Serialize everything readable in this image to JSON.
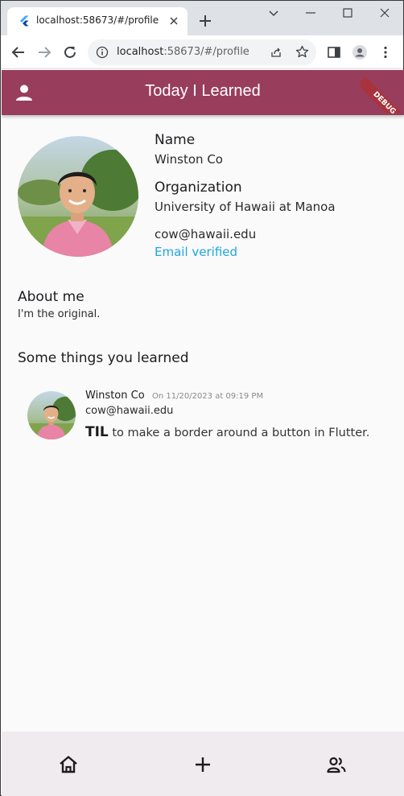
{
  "browser": {
    "tab_title": "localhost:58673/#/profile",
    "url_host": "localhost",
    "url_rest": ":58673/#/profile"
  },
  "app": {
    "title": "Today I Learned",
    "debug_banner": "DEBUG",
    "accent_color": "#993d5c"
  },
  "profile": {
    "name_label": "Name",
    "name": "Winston Co",
    "org_label": "Organization",
    "organization": "University of Hawaii at Manoa",
    "email": "cow@hawaii.edu",
    "email_status": "Email verified"
  },
  "about": {
    "title": "About me",
    "body": "I'm the original."
  },
  "learned": {
    "title": "Some things you learned",
    "items": [
      {
        "author": "Winston Co",
        "date": "On 11/20/2023 at 09:19 PM",
        "email": "cow@hawaii.edu",
        "prefix": "TIL",
        "text": " to make a border around a button in Flutter."
      }
    ]
  },
  "nav": {
    "icons": [
      "home-icon",
      "add-icon",
      "people-icon"
    ]
  }
}
